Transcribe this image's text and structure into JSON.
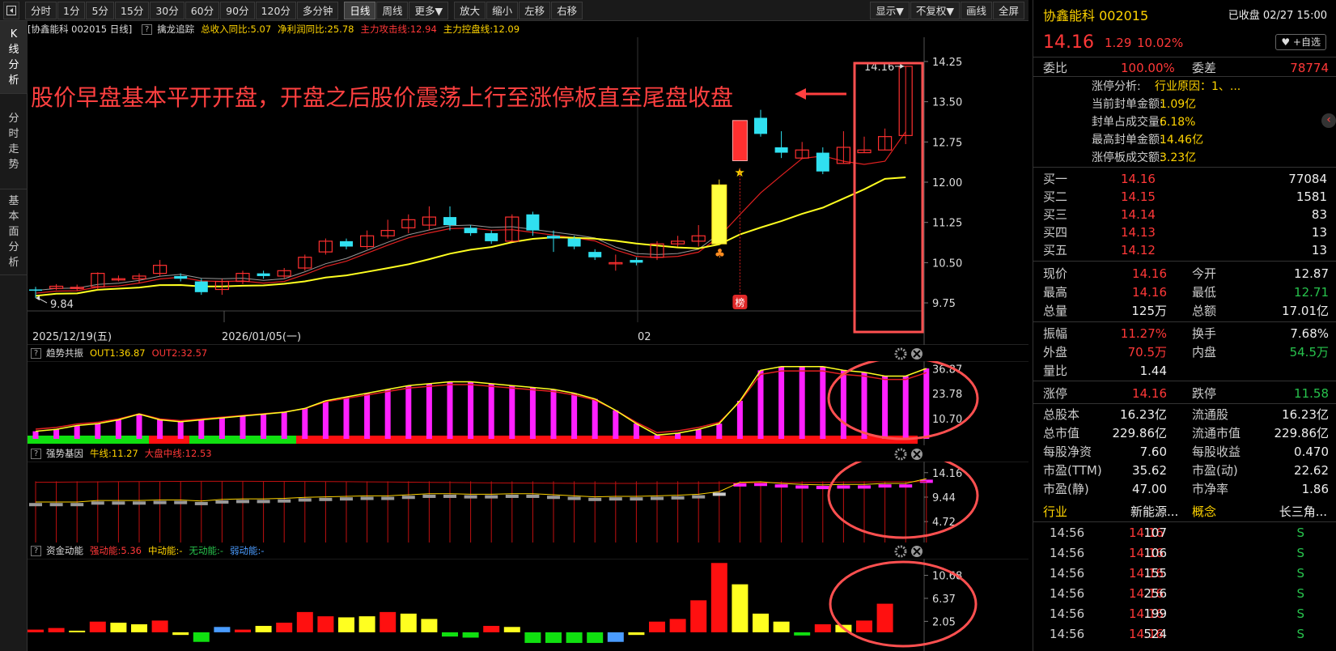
{
  "toolbar": {
    "back_icon": "panel-toggle-icon",
    "items": [
      "分时",
      "1分",
      "5分",
      "15分",
      "30分",
      "60分",
      "90分",
      "120分",
      "多分钟",
      "日线",
      "周线",
      "更多▼",
      "放大",
      "缩小",
      "左移",
      "右移"
    ],
    "active_index": 9,
    "right_items": [
      "显示▼",
      "不复权▼",
      "画线",
      "全屏"
    ]
  },
  "leftnav": {
    "items": [
      [
        "K",
        "线",
        "分",
        "析"
      ],
      [
        "分",
        "时",
        "走",
        "势"
      ],
      [
        "基",
        "本",
        "面",
        "分",
        "析"
      ]
    ]
  },
  "main_title": {
    "stock": "[协鑫能科 002015 日线]",
    "q": "?",
    "indicator": "擒龙追踪",
    "k1": "总收入同比:5.07",
    "k2": "净利润同比:25.78",
    "k3": "主力攻击线:12.94",
    "k4": "主力控盘线:12.09"
  },
  "annotation": {
    "text": "股价早盘基本平开开盘，开盘之后股价震荡上行至涨停板直至尾盘收盘"
  },
  "main_labels": {
    "high_price": "14.16",
    "low_price": "9.84",
    "date1": "2025/12/19(五)",
    "date2": "2026/01/05(一)",
    "date3": "02",
    "bang": "榜",
    "star": "★"
  },
  "price_axis": [
    "14.25",
    "13.50",
    "12.75",
    "12.00",
    "11.25",
    "10.50",
    "9.75"
  ],
  "panels": [
    {
      "q": "?",
      "name": "趋势共振",
      "k1": "OUT1:36.87",
      "k2": "OUT2:32.57",
      "axis": [
        "36.87",
        "23.78",
        "10.70"
      ]
    },
    {
      "q": "?",
      "name": "强势基因",
      "k1": "牛线:11.27",
      "k2": "大盘中线:12.53",
      "axis": [
        "14.16",
        "9.44",
        "4.72"
      ]
    },
    {
      "q": "?",
      "name": "资金动能",
      "k1": "强动能:5.36",
      "k2": "中动能:-",
      "k3": "无动能:-",
      "k4": "弱动能:-",
      "axis": [
        "10.68",
        "6.37",
        "2.05"
      ]
    }
  ],
  "panel_icons": [
    "gear-icon",
    "close-icon"
  ],
  "chart_data": [
    {
      "type": "candlestick",
      "title": "擒龙追踪",
      "candles": [
        [
          10.0,
          9.98,
          9.84,
          10.05
        ],
        [
          10.02,
          10.06,
          9.99,
          10.1
        ],
        [
          10.03,
          10.04,
          9.98,
          10.09
        ],
        [
          10.05,
          10.3,
          10.0,
          10.32
        ],
        [
          10.2,
          10.2,
          10.15,
          10.26
        ],
        [
          10.2,
          10.25,
          10.12,
          10.3
        ],
        [
          10.3,
          10.45,
          10.25,
          10.55
        ],
        [
          10.25,
          10.2,
          10.15,
          10.3
        ],
        [
          10.15,
          9.95,
          9.9,
          10.2
        ],
        [
          10.0,
          10.15,
          9.9,
          10.2
        ],
        [
          10.15,
          10.3,
          10.1,
          10.35
        ],
        [
          10.3,
          10.25,
          10.2,
          10.35
        ],
        [
          10.25,
          10.35,
          10.2,
          10.4
        ],
        [
          10.4,
          10.6,
          10.35,
          10.65
        ],
        [
          10.7,
          10.9,
          10.65,
          10.95
        ],
        [
          10.9,
          10.8,
          10.75,
          10.95
        ],
        [
          10.8,
          11.0,
          10.75,
          11.1
        ],
        [
          11.0,
          11.1,
          10.95,
          11.3
        ],
        [
          11.15,
          11.3,
          11.05,
          11.4
        ],
        [
          11.2,
          11.35,
          11.1,
          11.55
        ],
        [
          11.35,
          11.2,
          11.1,
          11.55
        ],
        [
          11.15,
          11.05,
          11.0,
          11.2
        ],
        [
          11.05,
          10.9,
          10.85,
          11.1
        ],
        [
          10.9,
          11.35,
          10.9,
          11.4
        ],
        [
          11.4,
          11.1,
          11.0,
          11.45
        ],
        [
          11.0,
          10.95,
          10.7,
          11.1
        ],
        [
          10.95,
          10.8,
          10.75,
          11.0
        ],
        [
          10.7,
          10.6,
          10.55,
          10.75
        ],
        [
          10.5,
          10.5,
          10.35,
          10.65
        ],
        [
          10.55,
          10.5,
          10.45,
          10.6
        ],
        [
          10.6,
          10.85,
          10.55,
          10.9
        ],
        [
          10.85,
          10.9,
          10.8,
          11.0
        ],
        [
          10.9,
          11.0,
          10.8,
          11.2
        ],
        [
          10.85,
          11.95,
          10.85,
          12.05
        ],
        [
          12.4,
          13.15,
          12.4,
          13.15
        ],
        [
          13.2,
          12.9,
          12.85,
          13.35
        ],
        [
          12.65,
          12.55,
          12.45,
          12.95
        ],
        [
          12.45,
          12.6,
          12.45,
          12.75
        ],
        [
          12.55,
          12.2,
          12.15,
          12.65
        ],
        [
          12.35,
          12.65,
          12.35,
          12.95
        ],
        [
          12.55,
          12.6,
          12.55,
          12.85
        ],
        [
          12.6,
          12.85,
          12.6,
          13.0
        ],
        [
          12.87,
          14.16,
          12.71,
          14.16
        ]
      ],
      "ma_red_end": 12.94,
      "ma_yellow_end": 12.09,
      "yrange": [
        9.6,
        14.4
      ]
    },
    {
      "type": "bar",
      "title": "趋势共振",
      "values": [
        4,
        5,
        7,
        8,
        10,
        13,
        10,
        9,
        10,
        11,
        12,
        13,
        14,
        16,
        20,
        22,
        24,
        26,
        28,
        29,
        30,
        30,
        29,
        28,
        27,
        26,
        24,
        21,
        15,
        8,
        2,
        3,
        5,
        8,
        20,
        36,
        38,
        38,
        38,
        36,
        35,
        33,
        33,
        37
      ],
      "yrange": [
        0,
        40
      ]
    },
    {
      "type": "bar",
      "title": "强势基因",
      "values": [
        8,
        8,
        8,
        8.3,
        8.3,
        8.3,
        8.4,
        8.4,
        8.2,
        8.5,
        8.6,
        8.6,
        8.7,
        8.9,
        9.0,
        9.1,
        9.2,
        9.2,
        9.4,
        9.6,
        9.6,
        9.5,
        9.5,
        9.6,
        9.6,
        9.4,
        9.2,
        9.0,
        9.1,
        9.1,
        9.2,
        9.3,
        9.5,
        10.0,
        11.8,
        11.9,
        11.6,
        11.4,
        11.3,
        11.4,
        11.4,
        11.6,
        11.6,
        12.5
      ],
      "yrange": [
        1,
        16
      ]
    },
    {
      "type": "bar",
      "title": "资金动能",
      "values": [
        0.5,
        0.8,
        0.3,
        2.0,
        1.8,
        1.5,
        2.2,
        -0.5,
        -1.8,
        1.0,
        0.5,
        1.2,
        1.8,
        3.8,
        3.0,
        2.8,
        3.0,
        3.8,
        3.5,
        2.5,
        -0.8,
        -1.0,
        1.2,
        1.0,
        -2.0,
        -2.0,
        -2.0,
        -2.0,
        -1.8,
        -0.5,
        2.0,
        2.5,
        6.0,
        13.0,
        9.0,
        3.5,
        2.0,
        -0.6,
        1.5,
        1.4,
        2.2,
        5.36
      ],
      "colors": [
        "r",
        "r",
        "y",
        "r",
        "y",
        "y",
        "r",
        "y",
        "g",
        "b",
        "r",
        "y",
        "r",
        "r",
        "r",
        "y",
        "y",
        "r",
        "y",
        "y",
        "g",
        "g",
        "r",
        "y",
        "g",
        "g",
        "g",
        "g",
        "b",
        "y",
        "r",
        "r",
        "r",
        "r",
        "y",
        "y",
        "y",
        "g",
        "r",
        "y",
        "r",
        "r"
      ],
      "yrange": [
        -2.6,
        13.5
      ]
    }
  ],
  "right": {
    "name": "协鑫能科 002015",
    "status": "已收盘 02/27 15:00",
    "price": "14.16",
    "chg": "1.29",
    "pct": "10.02%",
    "fav": "♥ +自选",
    "weibi_l": "委比",
    "weibi": "100.00%",
    "weicha_l": "委差",
    "weicha": "78774",
    "zt": [
      [
        "涨停分析:",
        "行业原因：1、..."
      ],
      [
        "当前封单金额:",
        "1.09亿"
      ],
      [
        "封单占成交量:",
        "6.18%"
      ],
      [
        "最高封单金额:",
        "14.46亿"
      ],
      [
        "涨停板成交额:",
        "3.23亿"
      ]
    ],
    "bids": [
      [
        "买一",
        "14.16",
        "77084"
      ],
      [
        "买二",
        "14.15",
        "1581"
      ],
      [
        "买三",
        "14.14",
        "83"
      ],
      [
        "买四",
        "14.13",
        "13"
      ],
      [
        "买五",
        "14.12",
        "13"
      ]
    ],
    "quote": [
      [
        "现价",
        "14.16",
        "今开",
        "12.87"
      ],
      [
        "最高",
        "14.16",
        "最低",
        "12.71"
      ],
      [
        "总量",
        "125万",
        "总额",
        "17.01亿"
      ]
    ],
    "quote2": [
      [
        "振幅",
        "11.27%",
        "换手",
        "7.68%"
      ],
      [
        "外盘",
        "70.5万",
        "内盘",
        "54.5万"
      ],
      [
        "量比",
        "1.44",
        "",
        ""
      ]
    ],
    "limits": [
      [
        "涨停",
        "14.16",
        "跌停",
        "11.58"
      ]
    ],
    "fund": [
      [
        "总股本",
        "16.23亿",
        "流通股",
        "16.23亿"
      ],
      [
        "总市值",
        "229.86亿",
        "流通市值",
        "229.86亿"
      ],
      [
        "每股净资",
        "7.60",
        "每股收益",
        "0.470"
      ],
      [
        "市盈(TTM)",
        "35.62",
        "市盈(动)",
        "22.62"
      ],
      [
        "市盈(静)",
        "47.00",
        "市净率",
        "1.86"
      ]
    ],
    "industry": [
      "行业",
      "新能源...",
      "概念",
      "长三角..."
    ],
    "ticks": [
      [
        "14:56",
        "14.16",
        "107",
        "S"
      ],
      [
        "14:56",
        "14.16",
        "106",
        "S"
      ],
      [
        "14:56",
        "14.16",
        "155",
        "S"
      ],
      [
        "14:56",
        "14.16",
        "256",
        "S"
      ],
      [
        "14:56",
        "14.16",
        "199",
        "S"
      ],
      [
        "14:56",
        "14.16",
        "524",
        "S"
      ]
    ],
    "collapse_icon": "chevron-left-icon"
  }
}
